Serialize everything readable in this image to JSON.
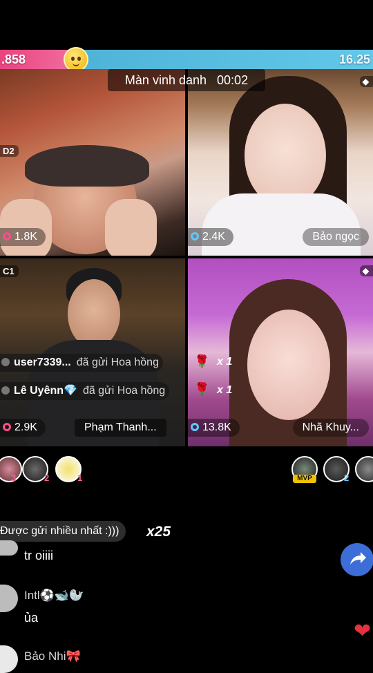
{
  "battle": {
    "left_score": ".858",
    "right_score": "16.25",
    "left_fraction": 0.2,
    "emoji_icon": "face-emoji-icon",
    "colors": {
      "left": "#e9437e",
      "right": "#4fb3d8"
    }
  },
  "honor_banner": {
    "label": "Màn vinh danh",
    "timer": "00:02"
  },
  "tiles": [
    {
      "rank": "D2",
      "viewers": "1.8K",
      "viewer_icon": "pk-icon"
    },
    {
      "rank": "◆",
      "viewers": "2.4K",
      "viewer_icon": "eye-icon",
      "name": "Bảo ngọc"
    },
    {
      "rank": "C1",
      "viewers": "2.9K",
      "viewer_icon": "pk-icon",
      "name": "Phạm Thanh..."
    },
    {
      "rank": "◆",
      "viewers": "13.8K",
      "viewer_icon": "eye-icon",
      "name": "Nhã Khuy..."
    }
  ],
  "gift_feed": [
    {
      "user": "user7339...",
      "action": "đã gửi Hoa hồng",
      "gift_icon": "rose-icon",
      "count": "x 1"
    },
    {
      "user": "Lê Uyênn💎",
      "action": "đã gửi Hoa hồng",
      "gift_icon": "rose-icon",
      "count": "x 1"
    }
  ],
  "top_gifters_left": [
    {
      "rank": "3"
    },
    {
      "rank": "2"
    },
    {
      "rank": "1"
    }
  ],
  "top_gifters_right": [
    {
      "badge": "MVP"
    },
    {
      "rank": "2"
    },
    {
      "rank": ""
    }
  ],
  "toast": {
    "text": "Được gửi nhiều nhất :)))",
    "count": "x25"
  },
  "chat": [
    {
      "name": "",
      "message": "tr oiiii"
    },
    {
      "name": "Intl⚽🐋🦭",
      "message": "ủa"
    },
    {
      "name": "Bảo Nhi🎀",
      "message": ""
    }
  ],
  "actions": {
    "share_icon": "share-arrow-icon",
    "like_icon": "heart-icon"
  }
}
